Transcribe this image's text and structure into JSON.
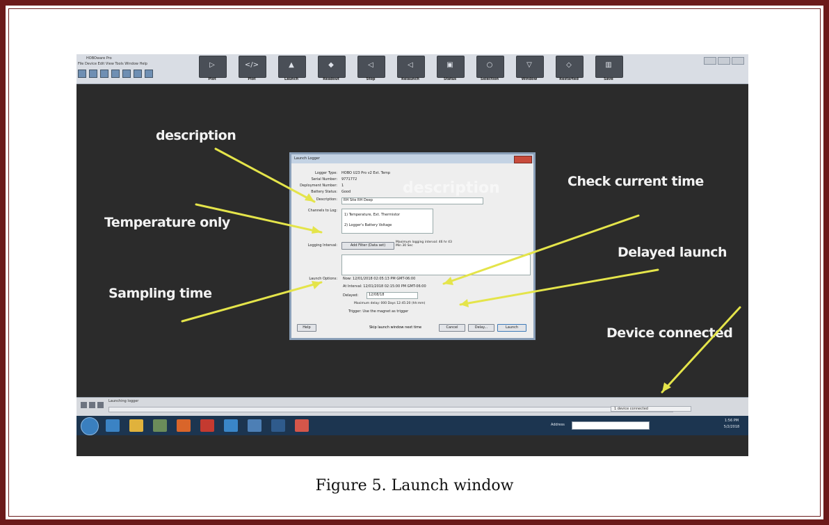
{
  "caption": "Figure 5. Launch window",
  "screenshot": {
    "app_title": "HOBOware Pro",
    "menu": "File  Device  Edit  View  Tools  Window  Help",
    "ribbon": [
      {
        "label": "Plot",
        "glyph": "▷"
      },
      {
        "label": "Plot",
        "glyph": "</>"
      },
      {
        "label": "Launch",
        "glyph": "▲"
      },
      {
        "label": "Readout",
        "glyph": "◆"
      },
      {
        "label": "Stop",
        "glyph": "◁"
      },
      {
        "label": "Relaunch",
        "glyph": "◁"
      },
      {
        "label": "Status",
        "glyph": "▣"
      },
      {
        "label": "Selection",
        "glyph": "○"
      },
      {
        "label": "Window",
        "glyph": "▽"
      },
      {
        "label": "Restarted",
        "glyph": "◇"
      },
      {
        "label": "Save",
        "glyph": "▥"
      }
    ],
    "status_text": "Launching logger",
    "status_connection": "1 device connected",
    "taskbar_address_label": "Address",
    "clock_time": "1:56 PM",
    "clock_date": "5/2/2018"
  },
  "dialog": {
    "title": "Launch Logger",
    "watermark": "description",
    "fields": [
      {
        "label": "Logger Type:",
        "value": "HOBO U23 Pro v2 Ext. Temp"
      },
      {
        "label": "Serial Number:",
        "value": "9771772"
      },
      {
        "label": "Deployment Number:",
        "value": "1"
      },
      {
        "label": "Battery Status:",
        "value": "Good"
      },
      {
        "label": "Description:",
        "value": "RH Site RH Deep"
      }
    ],
    "channels_label": "Channels to Log:",
    "channels": [
      "1) Temperature, Ext. Thermistor",
      "2) Logger's Battery Voltage"
    ],
    "logging_interval_label": "Logging Interval:",
    "logging_interval_button": "Add Filter (Data set)",
    "logging_interval_note": "Maximum logging interval: 46 hr 43 Min 30 Sec",
    "launch_options_label": "Launch Options:",
    "launch_now": "Now:  12/01/2018 02:05:13 PM GMT-06:00",
    "launch_at": "At Interval:  12/01/2018 02:15:00 PM GMT-06:00",
    "launch_delayed_label": "Delayed:",
    "launch_delayed_value": "12/08/18",
    "launch_note": "Maximum delay: 000 Days 12:45:20 (hh:mm)",
    "trigger": "Trigger:  Use the magnet as trigger",
    "help_button": "Help",
    "skip_checkbox": "Skip launch window next time",
    "cancel_button": "Cancel",
    "delay_button": "Delay...",
    "launch_button": "Launch"
  },
  "annotations": [
    {
      "text": "description"
    },
    {
      "text": "Temperature only"
    },
    {
      "text": "Sampling time"
    },
    {
      "text": "Check current time"
    },
    {
      "text": "Delayed launch"
    },
    {
      "text": "Device connected"
    }
  ],
  "colors": {
    "frame": "#6b1a1a",
    "screen_bg": "#2b2b2b",
    "arrow": "#e4e44a",
    "note_text": "#f2f2f2"
  }
}
